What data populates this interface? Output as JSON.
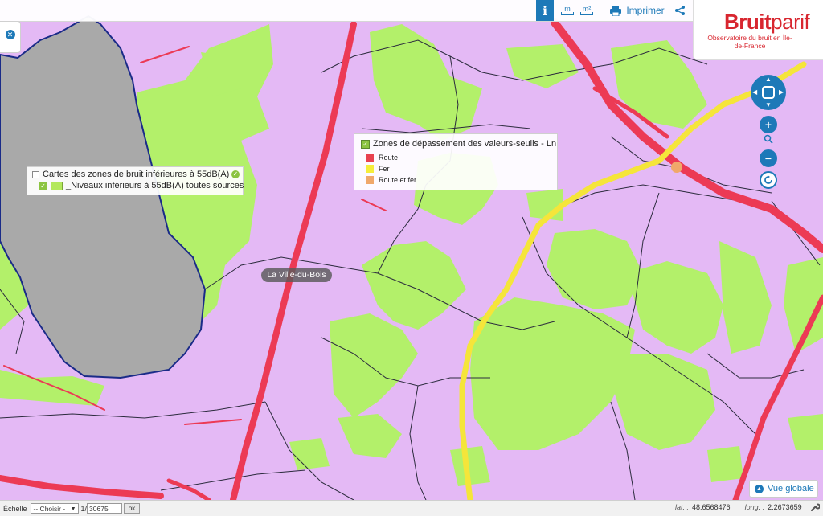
{
  "toolbar": {
    "info_label": "i",
    "m_label": "m",
    "m2_label": "m²",
    "print_label": "Imprimer"
  },
  "logo": {
    "word_a": "Bruit",
    "word_b": "parif",
    "subtitle": "Observatoire du bruit en Île-de-France"
  },
  "legend_left": {
    "group_label": "Cartes des zones de bruit inférieures à 55dB(A)",
    "layer_label": "_Niveaux inférieurs à 55dB(A) toutes sources"
  },
  "legend_right": {
    "layer_label": "Zones de dépassement des valeurs-seuils - Ln",
    "items": [
      {
        "label": "Route",
        "color": "#e8424f"
      },
      {
        "label": "Fer",
        "color": "#f5ee3a"
      },
      {
        "label": "Route et fer",
        "color": "#f0a86a"
      }
    ]
  },
  "map": {
    "place_label": "La Ville-du-Bois",
    "colors": {
      "background": "#e4b9f5",
      "low_noise": "#b3f06a",
      "commune_grey": "#a9a9a9",
      "road": "#ec3a55",
      "rail": "#f5e53a",
      "boundary": "#1a2b88"
    }
  },
  "controls": {
    "zoom_in": "+",
    "zoom_out": "−",
    "vue_globale": "Vue globale"
  },
  "bottom": {
    "echelle_label": "Échelle",
    "select_value": "-- Choisir -",
    "scale_prefix": "1/",
    "scale_value": "30675",
    "ok_label": "ok",
    "lat_label": "lat. :",
    "lat_value": "48.6568476",
    "long_label": "long. :",
    "long_value": "2.2673659"
  }
}
